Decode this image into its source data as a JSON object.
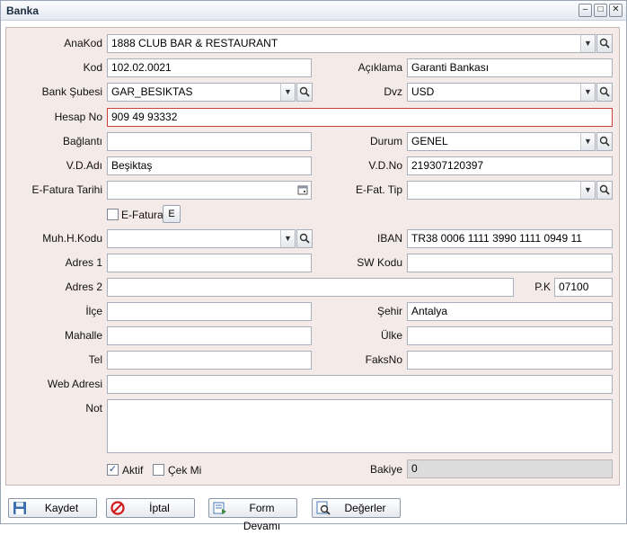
{
  "window": {
    "title": "Banka"
  },
  "titlebar_buttons": {
    "minimize": "–",
    "restore": "□",
    "close": "✕"
  },
  "form": {
    "anakod": {
      "label": "AnaKod",
      "value": "1888 CLUB BAR & RESTAURANT"
    },
    "kod": {
      "label": "Kod",
      "value": "102.02.0021"
    },
    "aciklama": {
      "label": "Açıklama",
      "value": "Garanti Bankası"
    },
    "bank_subesi": {
      "label": "Bank Şubesi",
      "value": "GAR_BESIKTAS"
    },
    "dvz": {
      "label": "Dvz",
      "value": "USD"
    },
    "hesap_no": {
      "label": "Hesap No",
      "value": "909 49 93332"
    },
    "baglanti": {
      "label": "Bağlantı",
      "value": ""
    },
    "durum": {
      "label": "Durum",
      "value": "GENEL"
    },
    "vd_adi": {
      "label": "V.D.Adı",
      "value": "Beşiktaş"
    },
    "vd_no": {
      "label": "V.D.No",
      "value": "219307120397"
    },
    "efatura_tarihi": {
      "label": "E-Fatura Tarihi",
      "value": ""
    },
    "efat_tip": {
      "label": "E-Fat. Tip",
      "value": ""
    },
    "efatura_check": {
      "label": "E-Fatura",
      "checked": false
    },
    "e_button": {
      "label": "E"
    },
    "muh_kodu": {
      "label": "Muh.H.Kodu",
      "value": ""
    },
    "iban": {
      "label": "IBAN",
      "value": "TR38 0006 1111 3990 1111 0949 11"
    },
    "adres1": {
      "label": "Adres 1",
      "value": ""
    },
    "sw_kodu": {
      "label": "SW Kodu",
      "value": ""
    },
    "adres2": {
      "label": "Adres 2",
      "value": ""
    },
    "pk": {
      "label": "P.K",
      "value": "07100"
    },
    "ilce": {
      "label": "İlçe",
      "value": ""
    },
    "sehir": {
      "label": "Şehir",
      "value": "Antalya"
    },
    "mahalle": {
      "label": "Mahalle",
      "value": ""
    },
    "ulke": {
      "label": "Ülke",
      "value": ""
    },
    "tel": {
      "label": "Tel",
      "value": ""
    },
    "faksno": {
      "label": "FaksNo",
      "value": ""
    },
    "web_adresi": {
      "label": "Web Adresi",
      "value": ""
    },
    "not": {
      "label": "Not",
      "value": ""
    },
    "aktif": {
      "label": "Aktif",
      "checked": true
    },
    "cek_mi": {
      "label": "Çek Mi",
      "checked": false
    },
    "bakiye": {
      "label": "Bakiye",
      "value": "0"
    }
  },
  "buttons": {
    "kaydet": "Kaydet",
    "iptal": "İptal",
    "form_devami": "Form Devamı",
    "degerler": "Değerler"
  },
  "icons": {
    "combo": "chevron-down-icon",
    "search": "magnifier-icon",
    "calendar": "calendar-icon",
    "check": "✓"
  }
}
